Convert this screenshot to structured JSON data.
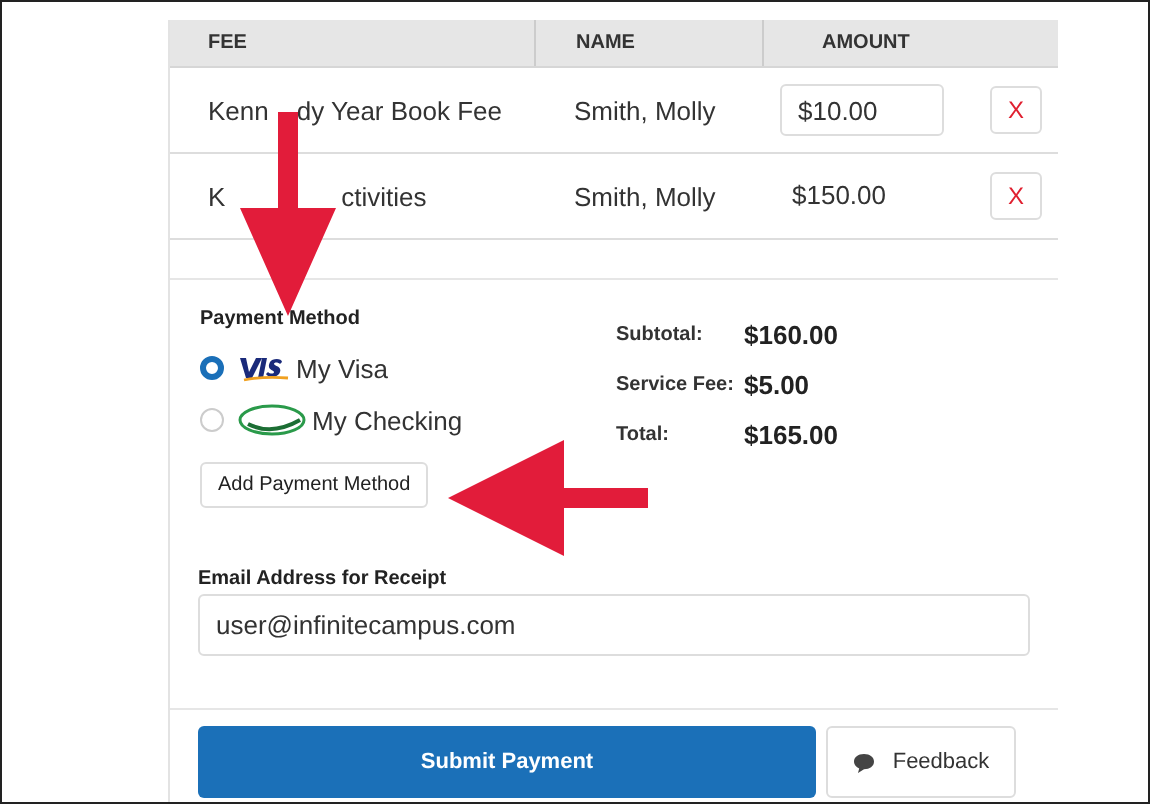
{
  "table": {
    "columns": [
      "FEE",
      "NAME",
      "AMOUNT"
    ],
    "rows": [
      {
        "fee": [
          "Kenn",
          "dy Year Book Fee"
        ],
        "name": "Smith, Molly",
        "amount": "$10.00",
        "kind": "input",
        "remove": "X"
      },
      {
        "fee": [
          "K",
          "ctivities"
        ],
        "name": "Smith, Molly",
        "amount": "$150.00",
        "kind": "text",
        "remove": "X"
      }
    ]
  },
  "payment": {
    "title": "Payment Method",
    "methods": [
      {
        "label": "My Visa",
        "kind": "visa",
        "selected": true
      },
      {
        "label": "My Checking",
        "kind": "echeck",
        "selected": false
      }
    ],
    "add_button": "Add Payment Method"
  },
  "totals": [
    {
      "label": "Subtotal:",
      "value": "$160.00"
    },
    {
      "label": "Service Fee:",
      "value": "$5.00"
    },
    {
      "label": "Total:",
      "value": "$165.00"
    }
  ],
  "email": {
    "label": "Email Address for Receipt",
    "value": "user@infinitecampus.com"
  },
  "submit": "Submit Payment",
  "feedback": "Feedback"
}
